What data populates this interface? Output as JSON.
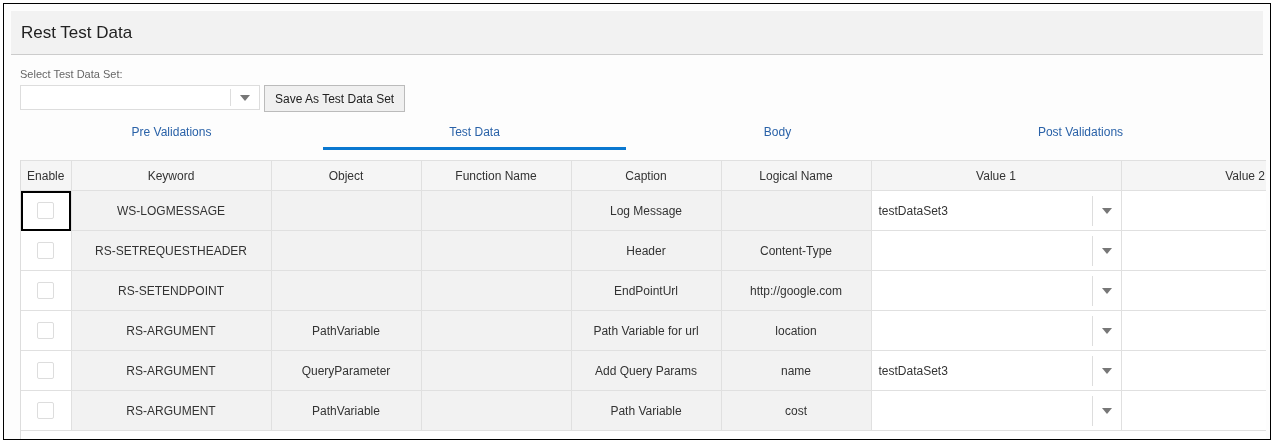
{
  "panel": {
    "title": "Rest Test Data"
  },
  "data_set": {
    "label": "Select Test Data Set:",
    "save_button": "Save As Test Data Set"
  },
  "tabs": [
    {
      "label": "Pre Validations",
      "selected": false
    },
    {
      "label": "Test Data",
      "selected": true
    },
    {
      "label": "Body",
      "selected": false
    },
    {
      "label": "Post Validations",
      "selected": false
    }
  ],
  "table": {
    "columns": [
      "Enable",
      "Keyword",
      "Object",
      "Function Name",
      "Caption",
      "Logical Name",
      "Value 1",
      "Value 2"
    ],
    "rows": [
      {
        "checked": false,
        "focused": true,
        "keyword": "WS-LOGMESSAGE",
        "caption": "Log Message",
        "value_1": "testDataSet3"
      },
      {
        "checked": false,
        "focused": false,
        "keyword": "RS-SETREQUESTHEADER",
        "caption": "Header",
        "logical_name": "Content-Type"
      },
      {
        "checked": false,
        "focused": false,
        "keyword": "RS-SETENDPOINT",
        "caption": "EndPointUrl",
        "logical_name": "http://google.com"
      },
      {
        "checked": false,
        "focused": false,
        "keyword": "RS-ARGUMENT",
        "object": "PathVariable",
        "caption": "Path Variable for url",
        "logical_name": "location"
      },
      {
        "checked": false,
        "focused": false,
        "keyword": "RS-ARGUMENT",
        "object": "QueryParameter",
        "caption": "Add Query Params",
        "logical_name": "name",
        "value_1": "testDataSet3"
      },
      {
        "checked": false,
        "focused": false,
        "keyword": "RS-ARGUMENT",
        "object": "PathVariable",
        "caption": "Path Variable",
        "logical_name": "cost"
      }
    ]
  }
}
